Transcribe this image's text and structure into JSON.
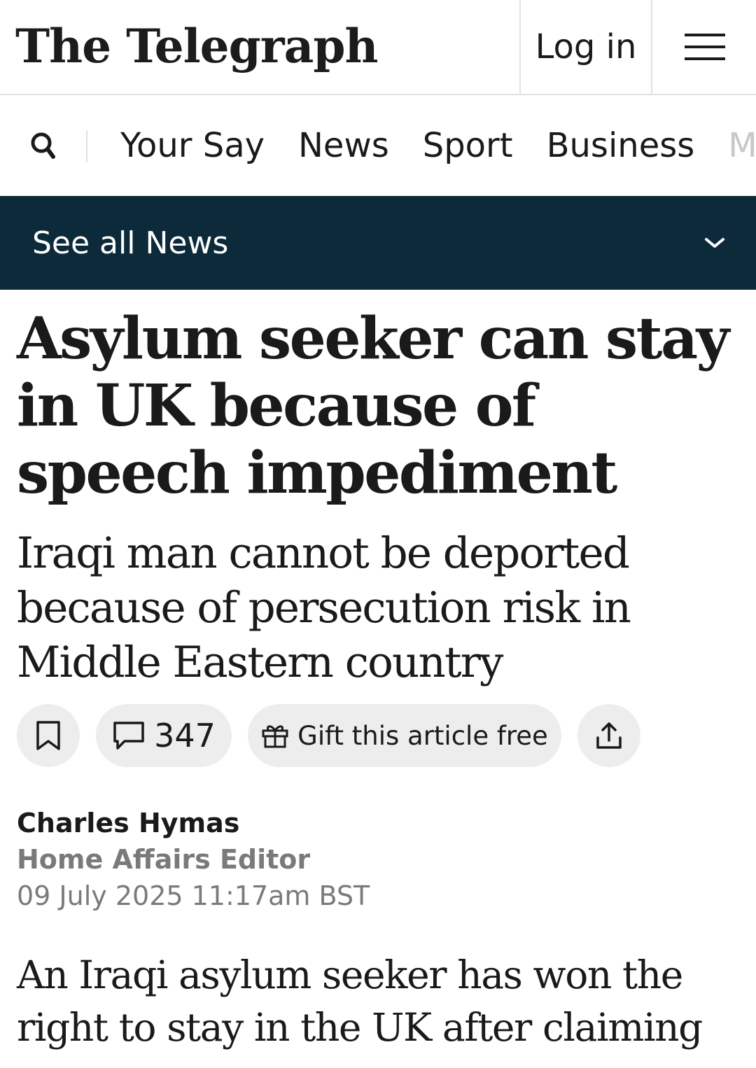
{
  "header": {
    "logo": "The Telegraph",
    "login_label": "Log in",
    "menu_icon": "hamburger-menu-icon"
  },
  "nav": {
    "search_icon": "search-icon",
    "items": [
      {
        "label": "Your Say"
      },
      {
        "label": "News"
      },
      {
        "label": "Sport"
      },
      {
        "label": "Business"
      },
      {
        "label": "M"
      }
    ]
  },
  "section_bar": {
    "label": "See all News",
    "icon": "chevron-down-icon",
    "background": "#0c2a3a"
  },
  "article": {
    "headline": "Asylum seeker can stay in UK because of speech impediment",
    "standfirst": "Iraqi man cannot be deported because of persecution risk in Middle Eastern country",
    "actions": {
      "bookmark_icon": "bookmark-icon",
      "comment_icon": "comment-icon",
      "comment_count": "347",
      "gift_icon": "gift-icon",
      "gift_label": "Gift this article free",
      "share_icon": "share-icon"
    },
    "author": {
      "name": "Charles Hymas",
      "role": "Home Affairs Editor",
      "date": "09 July 2025 11:17am BST"
    },
    "body_first": "An Iraqi asylum seeker has won the right to stay in the UK after claiming"
  }
}
